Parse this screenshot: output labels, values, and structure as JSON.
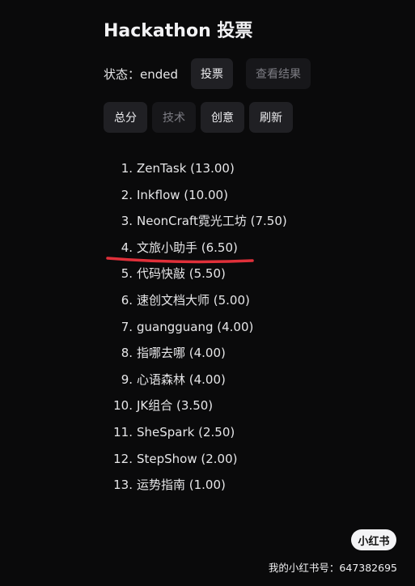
{
  "page": {
    "title": "Hackathon 投票"
  },
  "status": {
    "label": "状态：ended",
    "vote_button": "投票",
    "results_button": "查看结果"
  },
  "tabs": [
    {
      "label": "总分",
      "active": true
    },
    {
      "label": "技术",
      "active": false
    },
    {
      "label": "创意",
      "active": false
    },
    {
      "label": "刷新",
      "active": true
    }
  ],
  "ranking": [
    {
      "rank": "1.",
      "text": "ZenTask (13.00)"
    },
    {
      "rank": "2.",
      "text": "Inkflow (10.00)"
    },
    {
      "rank": "3.",
      "text": "NeonCraft霓光工坊 (7.50)"
    },
    {
      "rank": "4.",
      "text": "文旅小助手 (6.50)"
    },
    {
      "rank": "5.",
      "text": "代码快敲 (5.50)"
    },
    {
      "rank": "6.",
      "text": "速创文档大师 (5.00)"
    },
    {
      "rank": "7.",
      "text": "guangguang (4.00)"
    },
    {
      "rank": "8.",
      "text": "指哪去哪 (4.00)"
    },
    {
      "rank": "9.",
      "text": "心语森林 (4.00)"
    },
    {
      "rank": "10.",
      "text": "JK组合 (3.50)"
    },
    {
      "rank": "11.",
      "text": "SheSpark (2.50)"
    },
    {
      "rank": "12.",
      "text": "StepShow (2.00)"
    },
    {
      "rank": "13.",
      "text": "运势指南 (1.00)"
    }
  ],
  "annotation": {
    "color": "#e0303a"
  },
  "watermark": {
    "logo_text": "小红书",
    "text": "我的小红书号：647382695"
  }
}
